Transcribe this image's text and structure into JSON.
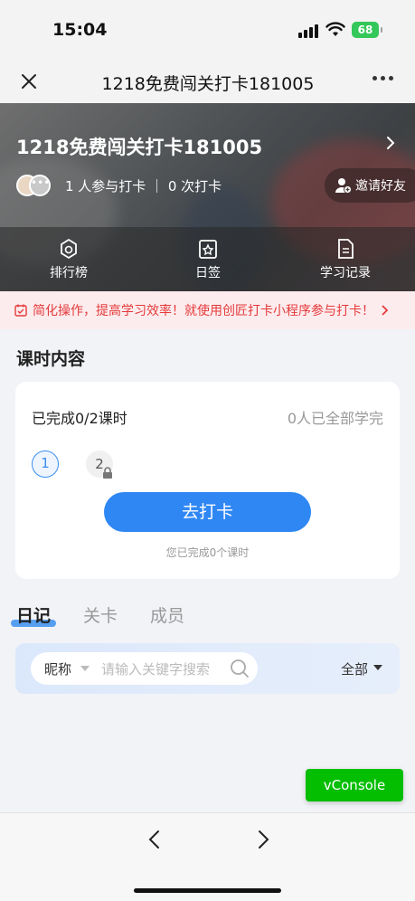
{
  "status_bar": {
    "time": "15:04",
    "battery": "68"
  },
  "nav": {
    "title": "1218免费闯关打卡181005"
  },
  "hero": {
    "title": "1218免费闯关打卡181005",
    "stats": "1 人参与打卡 ｜ 0 次打卡",
    "invite_label": "邀请好友",
    "actions": [
      {
        "label": "排行榜",
        "icon": "ranking-icon"
      },
      {
        "label": "日签",
        "icon": "daily-sign-icon"
      },
      {
        "label": "学习记录",
        "icon": "study-record-icon"
      }
    ]
  },
  "notice": {
    "text": "简化操作，提高学习效率！就使用创匠打卡小程序参与打卡！"
  },
  "lessons": {
    "section_title": "课时内容",
    "completed": "已完成0/2课时",
    "all_finished": "0人已全部学完",
    "items": [
      "1",
      "2"
    ],
    "checkin_button": "去打卡",
    "hint": "您已完成0个课时"
  },
  "tabs": [
    "日记",
    "关卡",
    "成员"
  ],
  "search": {
    "filter_label": "昵称",
    "placeholder": "请输入关键字搜索",
    "scope_label": "全部"
  },
  "vconsole": {
    "label": "vConsole"
  },
  "colors": {
    "accent": "#2f87f4",
    "notice": "#e43a3a",
    "vconsole": "#04be02"
  }
}
